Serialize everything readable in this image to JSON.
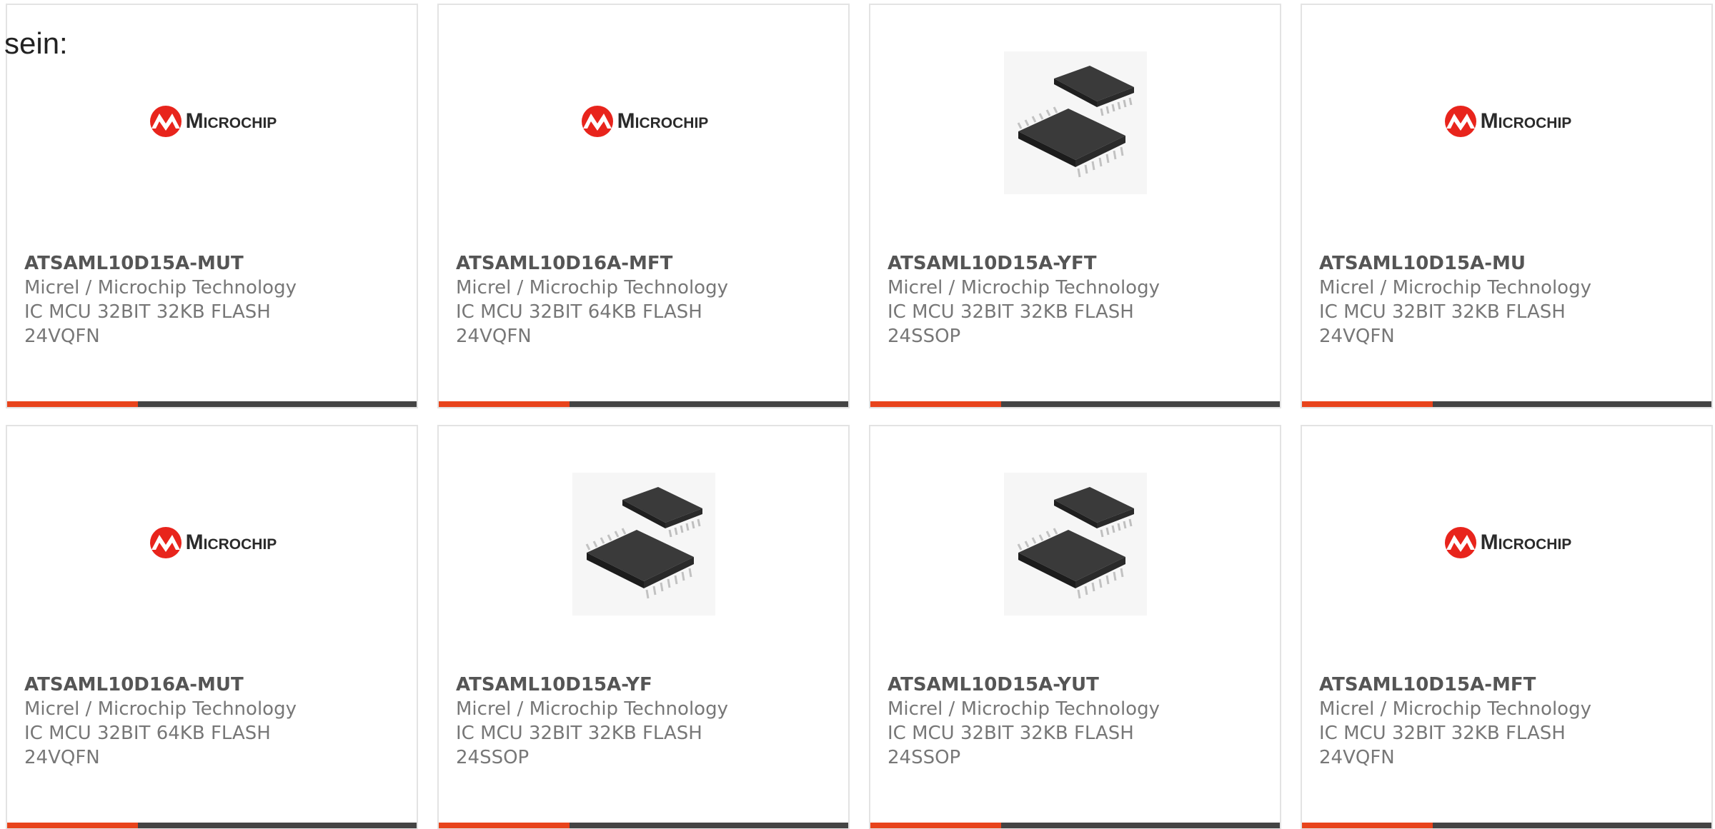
{
  "intro_text": "sein:",
  "logo": {
    "text": "Microchip",
    "color": "#e8241c"
  },
  "accent_color": "#e8441c",
  "products": [
    {
      "part": "ATSAML10D15A-MUT",
      "manufacturer": "Micrel / Microchip Technology",
      "description": "IC MCU 32BIT 32KB FLASH 24VQFN",
      "image": "microchip-logo"
    },
    {
      "part": "ATSAML10D16A-MFT",
      "manufacturer": "Micrel / Microchip Technology",
      "description": "IC MCU 32BIT 64KB FLASH 24VQFN",
      "image": "microchip-logo"
    },
    {
      "part": "ATSAML10D15A-YFT",
      "manufacturer": "Micrel / Microchip Technology",
      "description": "IC MCU 32BIT 32KB FLASH 24SSOP",
      "image": "ssop-chip-photo"
    },
    {
      "part": "ATSAML10D15A-MU",
      "manufacturer": "Micrel / Microchip Technology",
      "description": "IC MCU 32BIT 32KB FLASH 24VQFN",
      "image": "microchip-logo"
    },
    {
      "part": "ATSAML10D16A-MUT",
      "manufacturer": "Micrel / Microchip Technology",
      "description": "IC MCU 32BIT 64KB FLASH 24VQFN",
      "image": "microchip-logo"
    },
    {
      "part": "ATSAML10D15A-YF",
      "manufacturer": "Micrel / Microchip Technology",
      "description": "IC MCU 32BIT 32KB FLASH 24SSOP",
      "image": "ssop-chip-photo"
    },
    {
      "part": "ATSAML10D15A-YUT",
      "manufacturer": "Micrel / Microchip Technology",
      "description": "IC MCU 32BIT 32KB FLASH 24SSOP",
      "image": "ssop-chip-photo"
    },
    {
      "part": "ATSAML10D15A-MFT",
      "manufacturer": "Micrel / Microchip Technology",
      "description": "IC MCU 32BIT 32KB FLASH 24VQFN",
      "image": "microchip-logo"
    }
  ]
}
